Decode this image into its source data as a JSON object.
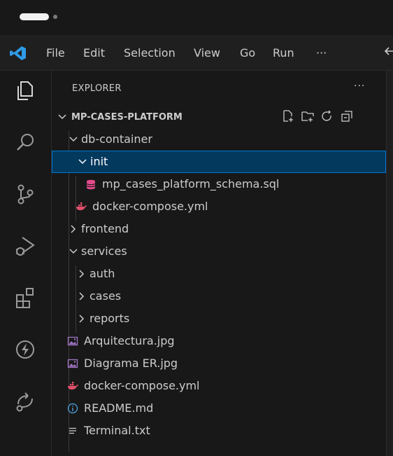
{
  "menubar": {
    "items": [
      "File",
      "Edit",
      "Selection",
      "View",
      "Go",
      "Run",
      "···"
    ]
  },
  "activity": {
    "icons": [
      "files-icon",
      "search-icon",
      "source-control-icon",
      "run-debug-icon",
      "extensions-icon",
      "lightning-icon",
      "remote-share-icon"
    ]
  },
  "explorer": {
    "title": "EXPLORER",
    "more": "···",
    "project": "MP-CASES-PLATFORM",
    "rows": [
      {
        "label": "db-container",
        "type": "folder",
        "expanded": true
      },
      {
        "label": "init",
        "type": "folder",
        "expanded": true,
        "selected": true
      },
      {
        "label": "mp_cases_platform_schema.sql",
        "type": "sql"
      },
      {
        "label": "docker-compose.yml",
        "type": "docker"
      },
      {
        "label": "frontend",
        "type": "folder",
        "expanded": false
      },
      {
        "label": "services",
        "type": "folder",
        "expanded": true
      },
      {
        "label": "auth",
        "type": "folder",
        "expanded": false
      },
      {
        "label": "cases",
        "type": "folder",
        "expanded": false
      },
      {
        "label": "reports",
        "type": "folder",
        "expanded": false
      },
      {
        "label": "Arquitectura.jpg",
        "type": "image"
      },
      {
        "label": "Diagrama ER.jpg",
        "type": "image"
      },
      {
        "label": "docker-compose.yml",
        "type": "docker"
      },
      {
        "label": "README.md",
        "type": "info"
      },
      {
        "label": "Terminal.txt",
        "type": "text"
      }
    ]
  },
  "colors": {
    "accent": "#0078d4",
    "selection_bg": "#04395e",
    "sql": "#e24b8c",
    "docker": "#e0506b"
  }
}
